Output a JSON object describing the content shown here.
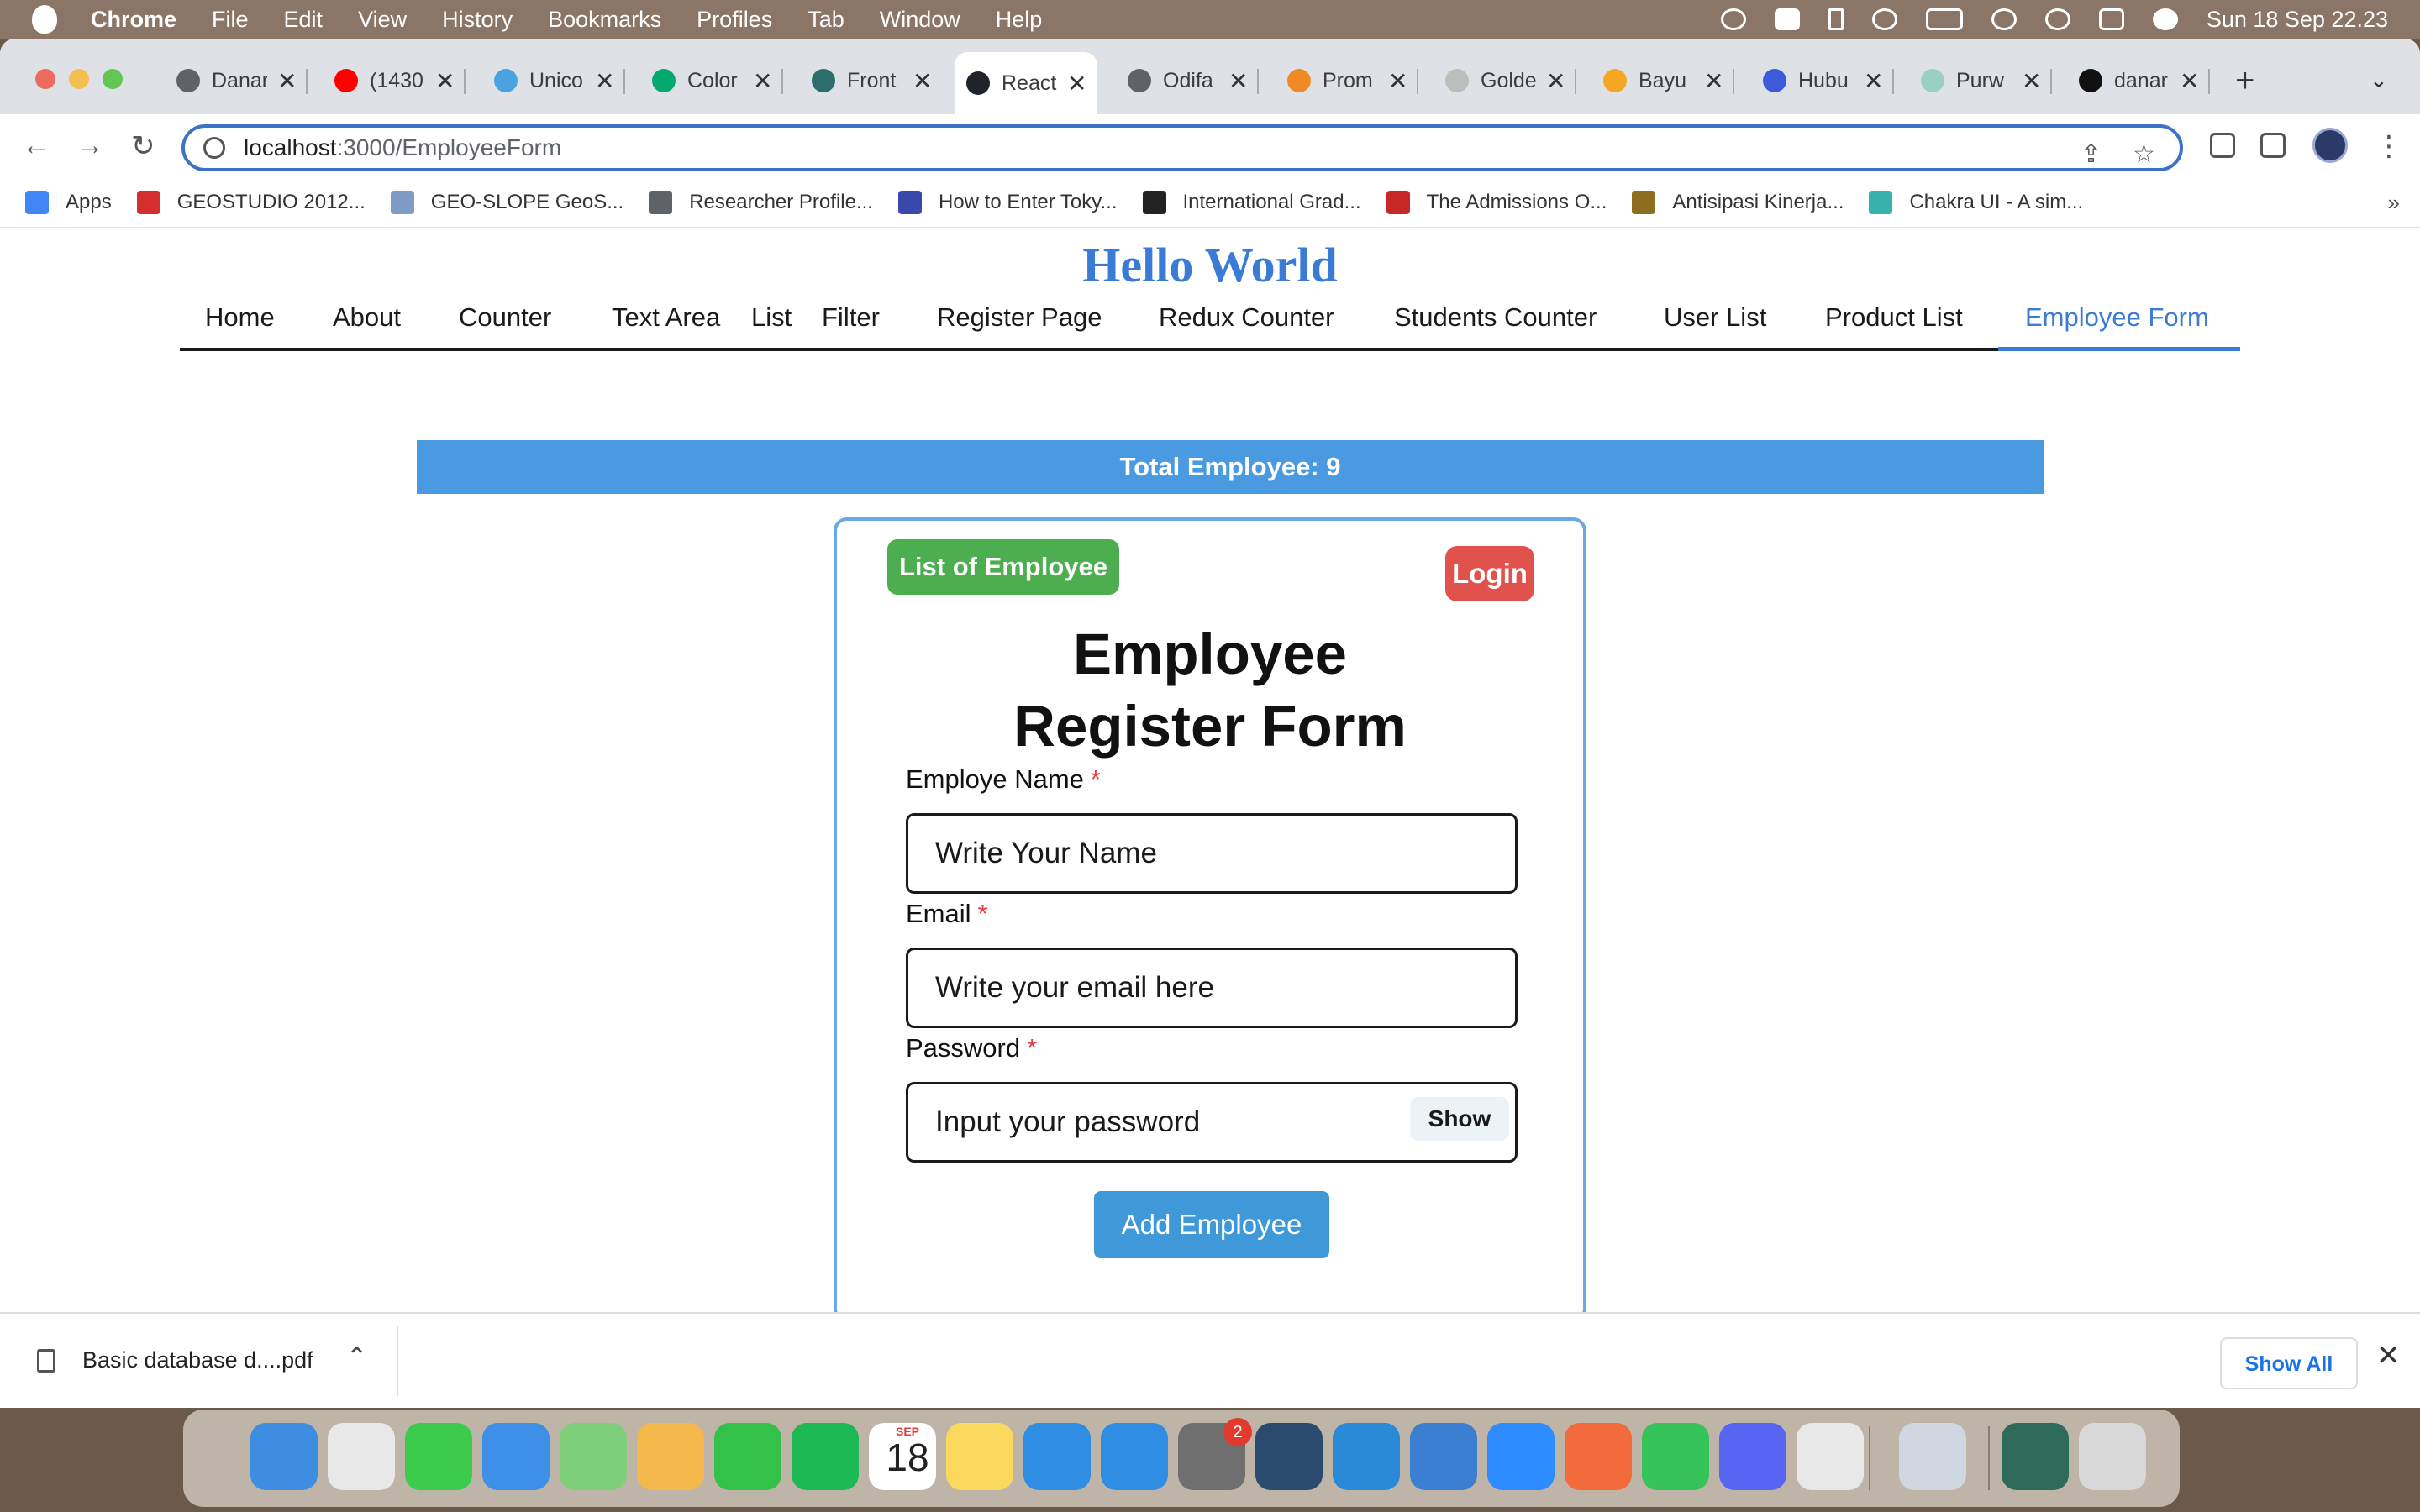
{
  "menubar": {
    "app": "Chrome",
    "items": [
      "File",
      "Edit",
      "View",
      "History",
      "Bookmarks",
      "Profiles",
      "Tab",
      "Window",
      "Help"
    ],
    "clock": "Sun 18 Sep  22.23"
  },
  "tabs": [
    {
      "label": "Danar",
      "icon": "globe-icon",
      "color": "#5f6368"
    },
    {
      "label": "(1430",
      "icon": "youtube-icon",
      "color": "#ff0000"
    },
    {
      "label": "Unico",
      "icon": "search-icon",
      "color": "#4aa3df"
    },
    {
      "label": "Color",
      "icon": "w3schools-icon",
      "color": "#04aa6d"
    },
    {
      "label": "Front",
      "icon": "frontend-icon",
      "color": "#2c6e6e"
    },
    {
      "label": "React",
      "icon": "react-icon",
      "color": "#20232a"
    },
    {
      "label": "Odifa",
      "icon": "globe-icon",
      "color": "#5f6368"
    },
    {
      "label": "Prom",
      "icon": "promo-icon",
      "color": "#f08a24"
    },
    {
      "label": "Golde",
      "icon": "golden-icon",
      "color": "#bdbdbd"
    },
    {
      "label": "Bayu",
      "icon": "bayu-icon",
      "color": "#f5a623"
    },
    {
      "label": "Hubu",
      "icon": "hubu-icon",
      "color": "#3b5bdb"
    },
    {
      "label": "Purw",
      "icon": "purw-icon",
      "color": "#9ad0c2"
    },
    {
      "label": "danar",
      "icon": "github-icon",
      "color": "#111111"
    }
  ],
  "address": {
    "host": "localhost",
    "path": ":3000/EmployeeForm"
  },
  "bookmarks": [
    {
      "label": "Apps",
      "icon": "apps-grid-icon",
      "color": "#4285f4"
    },
    {
      "label": "GEOSTUDIO 2012...",
      "icon": "geostudio-icon",
      "color": "#d32f2f"
    },
    {
      "label": "GEO-SLOPE GeoS...",
      "icon": "geoslope-icon",
      "color": "#7f9cc7"
    },
    {
      "label": "Researcher Profile...",
      "icon": "globe-icon",
      "color": "#5f6368"
    },
    {
      "label": "How to Enter Toky...",
      "icon": "tokyo-icon",
      "color": "#3949ab"
    },
    {
      "label": "International Grad...",
      "icon": "intl-grad-icon",
      "color": "#222222"
    },
    {
      "label": "The Admissions O...",
      "icon": "admissions-icon",
      "color": "#c62828"
    },
    {
      "label": "Antisipasi Kinerja...",
      "icon": "kinerja-icon",
      "color": "#8d6e1f"
    },
    {
      "label": "Chakra UI - A sim...",
      "icon": "chakra-icon",
      "color": "#38b2ac"
    }
  ],
  "page": {
    "hello": "Hello World",
    "nav": [
      "Home",
      "About",
      "Counter",
      "Text Area",
      "List",
      "Filter",
      "Register Page",
      "Redux Counter",
      "Students Counter",
      "User List",
      "Product List",
      "Employee Form"
    ],
    "total": "Total Employee: 9"
  },
  "form": {
    "list_button": "List of Employee",
    "login_button": "Login",
    "title": "Employee Register Form",
    "name_label": "Employe Name",
    "name_placeholder": "Write Your Name",
    "email_label": "Email",
    "email_placeholder": "Write your email here",
    "password_label": "Password",
    "password_placeholder": "Input your password",
    "required_mark": "*",
    "show_button": "Show",
    "submit_button": "Add Employee"
  },
  "download": {
    "file": "Basic database d....pdf",
    "show_all": "Show All"
  },
  "dock": {
    "calendar_month": "SEP",
    "calendar_day": "18",
    "badge": "2",
    "apps": [
      {
        "name": "finder-icon",
        "color": "#3d8ee0"
      },
      {
        "name": "launchpad-icon",
        "color": "#e8e8e8"
      },
      {
        "name": "messages-icon",
        "color": "#3ccb4c"
      },
      {
        "name": "mail-icon",
        "color": "#3d8fe8"
      },
      {
        "name": "maps-icon",
        "color": "#7ecf7a"
      },
      {
        "name": "photos-icon",
        "color": "#f5b84a"
      },
      {
        "name": "facetime-icon",
        "color": "#33c14a"
      },
      {
        "name": "spotify-icon",
        "color": "#1db954"
      },
      {
        "name": "calendar-icon",
        "color": "#ffffff"
      },
      {
        "name": "notes-icon",
        "color": "#fbd95c"
      },
      {
        "name": "keynote-icon",
        "color": "#2f8de4"
      },
      {
        "name": "appstore-icon",
        "color": "#2f8de4"
      },
      {
        "name": "system-preferences-icon",
        "color": "#6f6f6f"
      },
      {
        "name": "mysql-workbench-icon",
        "color": "#2a4a6e"
      },
      {
        "name": "vscode-icon",
        "color": "#2a8ad8"
      },
      {
        "name": "xcode-icon",
        "color": "#3a7fd0"
      },
      {
        "name": "zoom-icon",
        "color": "#2d8cff"
      },
      {
        "name": "pen-app-icon",
        "color": "#f36b3b"
      },
      {
        "name": "whatsapp-icon",
        "color": "#35c35a"
      },
      {
        "name": "discord-icon",
        "color": "#5865f2"
      },
      {
        "name": "chrome-icon",
        "color": "#e8e8e8"
      },
      {
        "name": "preview-icon",
        "color": "#cfd8e0"
      },
      {
        "name": "screenshot-thumb-icon",
        "color": "#2f6b5a"
      },
      {
        "name": "trash-icon",
        "color": "#d8d8d8"
      }
    ]
  }
}
